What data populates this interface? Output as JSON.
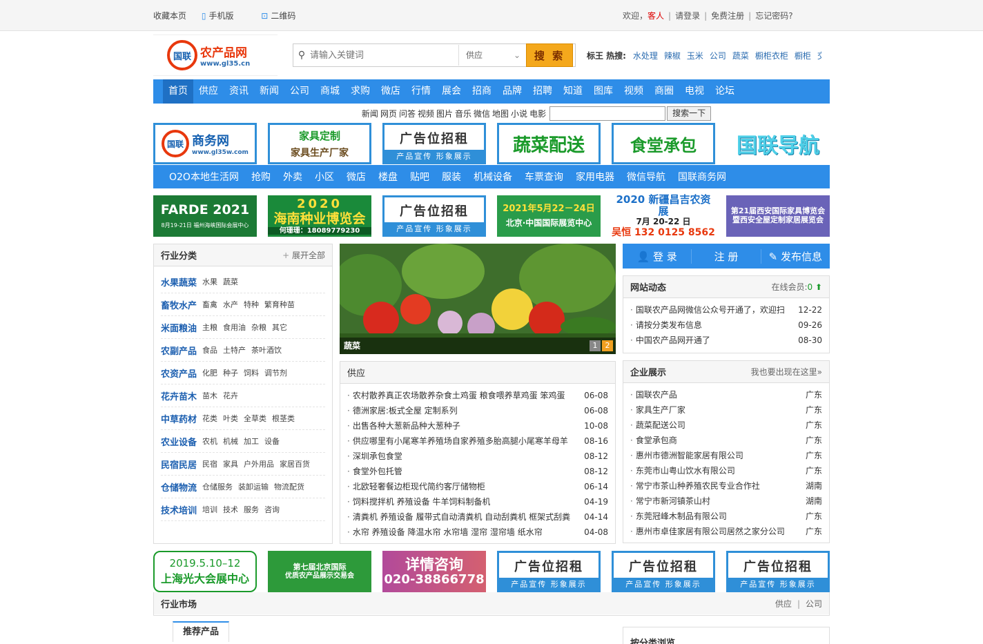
{
  "topbar": {
    "bookmark": "收藏本页",
    "mobile": "手机版",
    "qrcode": "二维码",
    "welcome": "欢迎，",
    "guest": "客人",
    "login": "请登录",
    "register": "免费注册",
    "forgot": "忘记密码?"
  },
  "logo": {
    "mark": "国联",
    "cn": "农产品网",
    "en": "www.gl35.cn"
  },
  "search": {
    "placeholder": "请输入关键词",
    "category": "供应",
    "button": "搜 索"
  },
  "hot": {
    "label": "标王 热搜:",
    "items": [
      "水处理",
      "辣椒",
      "玉米",
      "公司",
      "蔬菜",
      "橱柜衣柜",
      "橱柜",
      "交"
    ]
  },
  "nav": [
    "首页",
    "供应",
    "资讯",
    "新闻",
    "公司",
    "商城",
    "求购",
    "微店",
    "行情",
    "展会",
    "招商",
    "品牌",
    "招聘",
    "知道",
    "图库",
    "视频",
    "商圈",
    "电视",
    "论坛"
  ],
  "subsearch": {
    "links": [
      "新闻",
      "网页",
      "问答",
      "视频",
      "图片",
      "音乐",
      "微信",
      "地图",
      "小说",
      "电影"
    ],
    "button": "搜索一下"
  },
  "ads1": [
    {
      "t1": "商务网",
      "t2": "www.gl35w.com"
    },
    {
      "t1": "家具定制",
      "t2": "家具生产厂家"
    },
    {
      "t1": "广告位招租",
      "t2": "产品宣传 形象展示"
    },
    {
      "t1": "蔬菜配送"
    },
    {
      "t1": "食堂承包"
    },
    {
      "t1": "国联导航"
    }
  ],
  "subnav": [
    "O2O本地生活网",
    "抢购",
    "外卖",
    "小区",
    "微店",
    "楼盘",
    "贴吧",
    "服装",
    "机械设备",
    "车票查询",
    "家用电器",
    "微信导航",
    "国联商务网"
  ],
  "ads2": [
    {
      "t1": "FARDE 2021",
      "t2": "8月19-21日 福州海峡国际会展中心"
    },
    {
      "t1": "2020",
      "t2": "海南种业博览会",
      "t3": "何珊珊：18089779230"
    },
    {
      "t1": "广告位招租",
      "t2": "产品宣传 形象展示"
    },
    {
      "t1": "2021年5月22－24日",
      "t2": "北京·中国国际展览中心"
    },
    {
      "t1": "2020 新疆昌吉农资展",
      "t2": "7月 20-22 日",
      "t3": "吴恒 132 0125 8562"
    },
    {
      "t1": "第21届西安国际家具博览会",
      "t2": "暨西安全屋定制家居展览会"
    }
  ],
  "categories": {
    "title": "行业分类",
    "expand": "展开全部",
    "rows": [
      {
        "main": "水果蔬菜",
        "subs": [
          "水果",
          "蔬菜"
        ]
      },
      {
        "main": "畜牧水产",
        "subs": [
          "畜禽",
          "水产",
          "特种",
          "繁育种苗"
        ]
      },
      {
        "main": "米面粮油",
        "subs": [
          "主粮",
          "食用油",
          "杂粮",
          "其它"
        ]
      },
      {
        "main": "农副产品",
        "subs": [
          "食品",
          "土特产",
          "茶叶酒饮"
        ]
      },
      {
        "main": "农资产品",
        "subs": [
          "化肥",
          "种子",
          "饲料",
          "调节剂"
        ]
      },
      {
        "main": "花卉苗木",
        "subs": [
          "苗木",
          "花卉"
        ]
      },
      {
        "main": "中草药材",
        "subs": [
          "花类",
          "叶类",
          "全草类",
          "根茎类"
        ]
      },
      {
        "main": "农业设备",
        "subs": [
          "农机",
          "机械",
          "加工",
          "设备"
        ]
      },
      {
        "main": "民宿民居",
        "subs": [
          "民宿",
          "家具",
          "户外用品",
          "家居百货"
        ]
      },
      {
        "main": "仓储物流",
        "subs": [
          "仓储服务",
          "装卸运输",
          "物流配货"
        ]
      },
      {
        "main": "技术培训",
        "subs": [
          "培训",
          "技术",
          "服务",
          "咨询"
        ]
      }
    ]
  },
  "slide": {
    "caption": "蔬菜",
    "pages": [
      "1",
      "2"
    ]
  },
  "supply": {
    "title": "供应",
    "items": [
      {
        "t": "农村散养真正农场散养杂食土鸡蛋 粮食喂养草鸡蛋 笨鸡蛋",
        "d": "06-08"
      },
      {
        "t": "德洲家居:板式全屋 定制系列",
        "d": "06-08"
      },
      {
        "t": "出售各种大葱新品种大葱种子",
        "d": "10-08"
      },
      {
        "t": "供应哪里有小尾寒羊养殖场自家养殖多胎高腿小尾寒羊母羊",
        "d": "08-16"
      },
      {
        "t": "深圳承包食堂",
        "d": "08-12"
      },
      {
        "t": "食堂外包托管",
        "d": "08-12"
      },
      {
        "t": "北欧轻奢餐边柜现代简约客厅储物柜",
        "d": "06-14"
      },
      {
        "t": "饲料搅拌机 养殖设备 牛羊饲料制备机",
        "d": "04-19"
      },
      {
        "t": "清粪机 养殖设备 履带式自动清粪机 自动刮粪机 框架式刮粪",
        "d": "04-14"
      },
      {
        "t": "水帘 养殖设备 降温水帘 水帘墙 湿帘 湿帘墙 纸水帘",
        "d": "04-08"
      }
    ]
  },
  "actions": {
    "login": "登 录",
    "register": "注 册",
    "publish": "发布信息"
  },
  "news": {
    "title": "网站动态",
    "online": "在线会员:",
    "count": "0",
    "items": [
      {
        "t": "国联农产品网微信公众号开通了，欢迎扫",
        "d": "12-22"
      },
      {
        "t": "请按分类发布信息",
        "d": "09-26"
      },
      {
        "t": "中国农产品网开通了",
        "d": "08-30"
      }
    ]
  },
  "companies": {
    "title": "企业展示",
    "more": "我也要出现在这里»",
    "items": [
      {
        "t": "国联农产品",
        "d": "广东"
      },
      {
        "t": "家具生产厂家",
        "d": "广东"
      },
      {
        "t": "蔬菜配送公司",
        "d": "广东"
      },
      {
        "t": "食堂承包商",
        "d": "广东"
      },
      {
        "t": "惠州市德洲智能家居有限公司",
        "d": "广东"
      },
      {
        "t": "东莞市山粤山饮水有限公司",
        "d": "广东"
      },
      {
        "t": "常宁市茶山种养殖农民专业合作社",
        "d": "湖南"
      },
      {
        "t": "常宁市新河镇茶山村",
        "d": "湖南"
      },
      {
        "t": "东莞冠峰木制品有限公司",
        "d": "广东"
      },
      {
        "t": "惠州市卓佳家居有限公司居然之家分公司",
        "d": "广东"
      }
    ]
  },
  "ads3": [
    {
      "t1": "2019.5.10–12",
      "t2": "上海光大会展中心"
    },
    {
      "t1": "第七届北京国际",
      "t2": "优质农产品展示交易会"
    },
    {
      "t1": "详情咨询",
      "t2": "020-38866778"
    },
    {
      "t1": "广告位招租",
      "t2": "产品宣传 形象展示"
    },
    {
      "t1": "广告位招租",
      "t2": "产品宣传 形象展示"
    },
    {
      "t1": "广告位招租",
      "t2": "产品宣传 形象展示"
    }
  ],
  "market": {
    "title": "行业市场",
    "supply": "供应",
    "company": "公司",
    "tab": "推荐产品",
    "browse": "按分类浏览"
  }
}
